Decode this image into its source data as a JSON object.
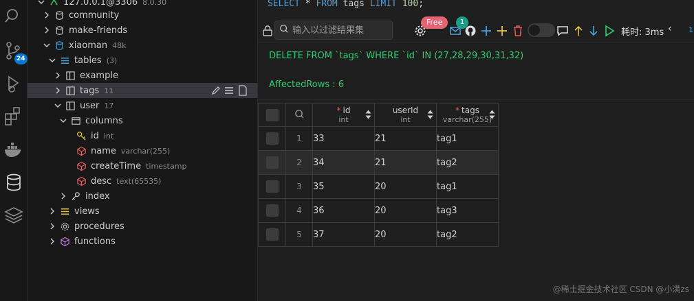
{
  "activity_bar": {
    "scm_badge": "24"
  },
  "tree": {
    "connection_label": "127.0.0.1@3306",
    "connection_version": "8.0.30",
    "items": [
      {
        "label": "community"
      },
      {
        "label": "make-friends"
      },
      {
        "label": "xiaoman",
        "desc": "48k"
      },
      {
        "label": "tables",
        "desc": "(3)"
      },
      {
        "label": "example"
      },
      {
        "label": "tags",
        "desc": "11"
      },
      {
        "label": "user",
        "desc": "17"
      },
      {
        "label": "columns"
      },
      {
        "label": "id",
        "desc": "int"
      },
      {
        "label": "name",
        "desc": "varchar(255)"
      },
      {
        "label": "createTime",
        "desc": "timestamp"
      },
      {
        "label": "desc",
        "desc": "text(65535)"
      },
      {
        "label": "index"
      },
      {
        "label": "views"
      },
      {
        "label": "procedures"
      },
      {
        "label": "functions"
      }
    ]
  },
  "editor": {
    "sql_select": "SELECT",
    "sql_star": "*",
    "sql_from": "FROM",
    "sql_table": "tags",
    "sql_limit": "LIMIT",
    "sql_limit_value": "100",
    "sql_end": ";"
  },
  "toolbar": {
    "search_placeholder": "输入以过滤结果集",
    "free_badge": "Free",
    "count_badge": "1",
    "timing": "耗时: 3ms",
    "prev": "‹",
    "page": "1"
  },
  "message": {
    "sql": "DELETE FROM `tags` WHERE `id` IN (27,28,29,30,31,32)",
    "affected": "AffectedRows : 6"
  },
  "table": {
    "columns": [
      {
        "name": "id",
        "type": "int",
        "required": true
      },
      {
        "name": "userId",
        "type": "int",
        "required": false
      },
      {
        "name": "tags",
        "type": "varchar(255)",
        "required": true
      }
    ],
    "rows": [
      {
        "index": "1",
        "id": "33",
        "userId": "21",
        "tags": "tag1"
      },
      {
        "index": "2",
        "id": "34",
        "userId": "21",
        "tags": "tag2"
      },
      {
        "index": "3",
        "id": "35",
        "userId": "20",
        "tags": "tag1"
      },
      {
        "index": "4",
        "id": "36",
        "userId": "20",
        "tags": "tag3"
      },
      {
        "index": "5",
        "id": "37",
        "userId": "20",
        "tags": "tag2"
      }
    ]
  },
  "watermark": "@稀土掘金技术社区 CSDN @小满zs",
  "colors": {
    "accent": "#0078d4",
    "message_green": "#2fcc71",
    "free_badge": "#e36473",
    "count_badge": "#1e9e88"
  },
  "icons": [
    "search-icon",
    "source-control-icon",
    "run-debug-icon",
    "extensions-icon",
    "docker-icon",
    "database-icon",
    "layers-icon",
    "lock-icon",
    "settings-icon",
    "mail-icon",
    "github-icon",
    "plus-icon",
    "trash-icon",
    "comment-icon",
    "arrow-up-icon",
    "arrow-down-icon",
    "play-icon"
  ]
}
